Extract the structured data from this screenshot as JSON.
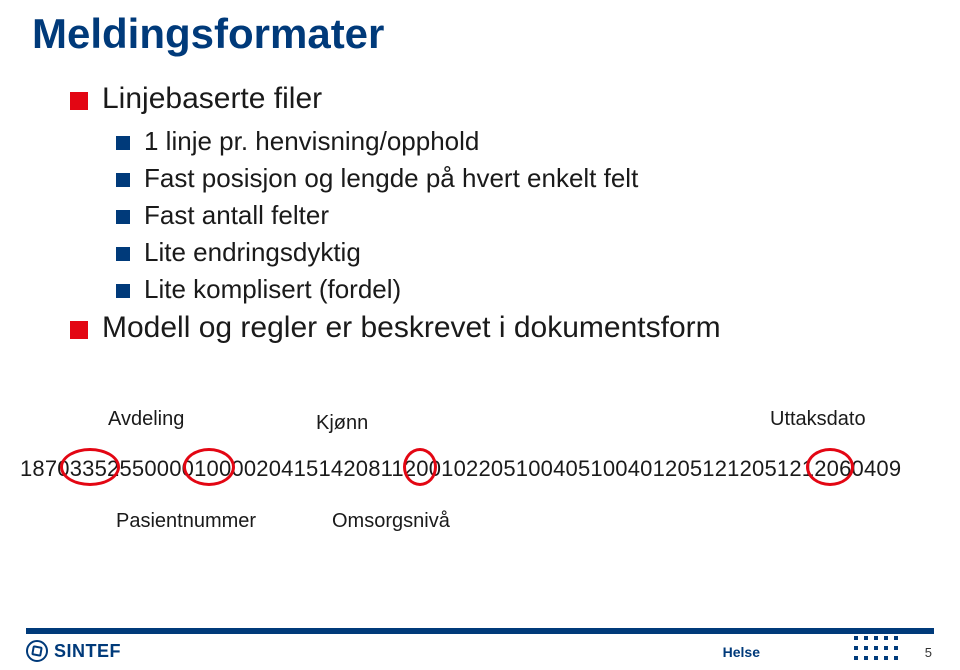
{
  "title": "Meldingsformater",
  "bullets": {
    "b1": "Linjebaserte filer",
    "b1_1": "1 linje pr. henvisning/opphold",
    "b1_2": "Fast posisjon og lengde på hvert enkelt felt",
    "b1_3": "Fast antall felter",
    "b1_4": "Lite endringsdyktig",
    "b1_5": "Lite komplisert (fordel)",
    "b2": "Modell og regler er beskrevet i dokumentsform"
  },
  "diagram": {
    "labels": {
      "avdeling": "Avdeling",
      "kjonn": "Kjønn",
      "uttaksdato": "Uttaksdato",
      "pasientnummer": "Pasientnummer",
      "omsorgsniva": "Omsorgsnivå"
    },
    "data_strings": {
      "s1": "18703352550000100002041514208112001022051004051004012051212051212060409"
    }
  },
  "footer": {
    "logo_text": "SINTEF",
    "section": "Helse",
    "page": "5"
  }
}
